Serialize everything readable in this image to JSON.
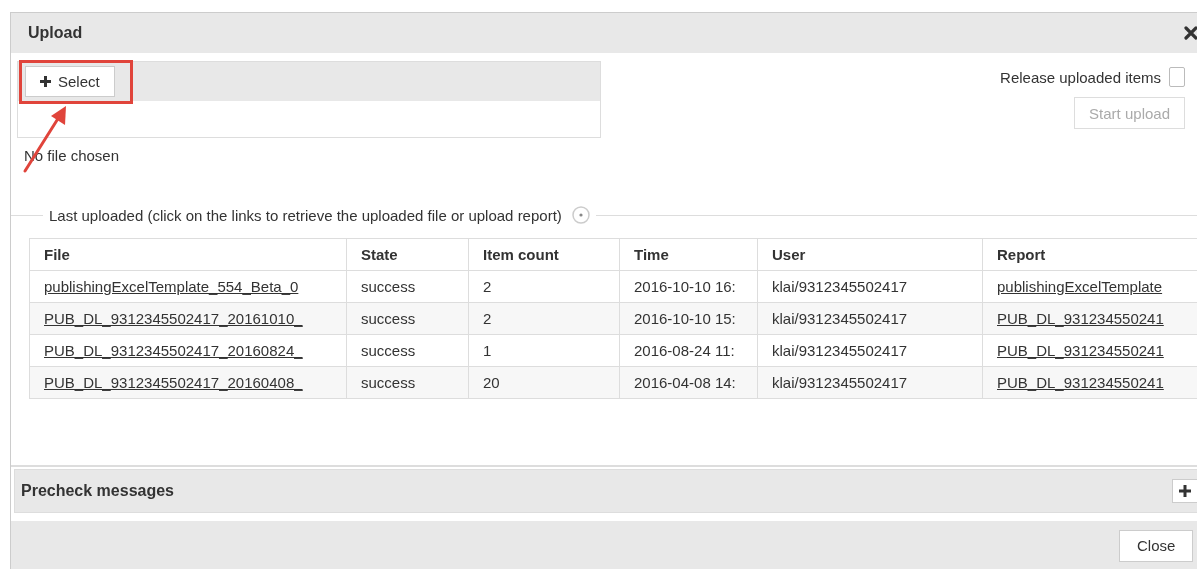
{
  "window": {
    "title": "Upload"
  },
  "upload": {
    "select_button": "Select",
    "file_status": "No file chosen",
    "release": {
      "label": "Release uploaded items",
      "checked": false
    },
    "start_button": {
      "label": "Start upload",
      "disabled": true
    }
  },
  "last_uploaded": {
    "legend": "Last uploaded (click on the links to retrieve the uploaded file or upload report)",
    "table": {
      "columns": [
        "File",
        "State",
        "Item count",
        "Time",
        "User",
        "Report"
      ],
      "rows": [
        {
          "file": "publishingExcelTemplate_554_Beta_0",
          "state": "success",
          "item_count": "2",
          "time": "2016-10-10 16:",
          "user": "klai/9312345502417",
          "report": "publishingExcelTemplate"
        },
        {
          "file": "PUB_DL_9312345502417_20161010_",
          "state": "success",
          "item_count": "2",
          "time": "2016-10-10 15:",
          "user": "klai/9312345502417",
          "report": "PUB_DL_931234550241"
        },
        {
          "file": "PUB_DL_9312345502417_20160824_",
          "state": "success",
          "item_count": "1",
          "time": "2016-08-24 11:",
          "user": "klai/9312345502417",
          "report": "PUB_DL_931234550241"
        },
        {
          "file": "PUB_DL_9312345502417_20160408_",
          "state": "success",
          "item_count": "20",
          "time": "2016-04-08 14:",
          "user": "klai/9312345502417",
          "report": "PUB_DL_931234550241"
        }
      ]
    }
  },
  "precheck": {
    "title": "Precheck messages",
    "expanded": false
  },
  "buttons": [
    "Close"
  ]
}
